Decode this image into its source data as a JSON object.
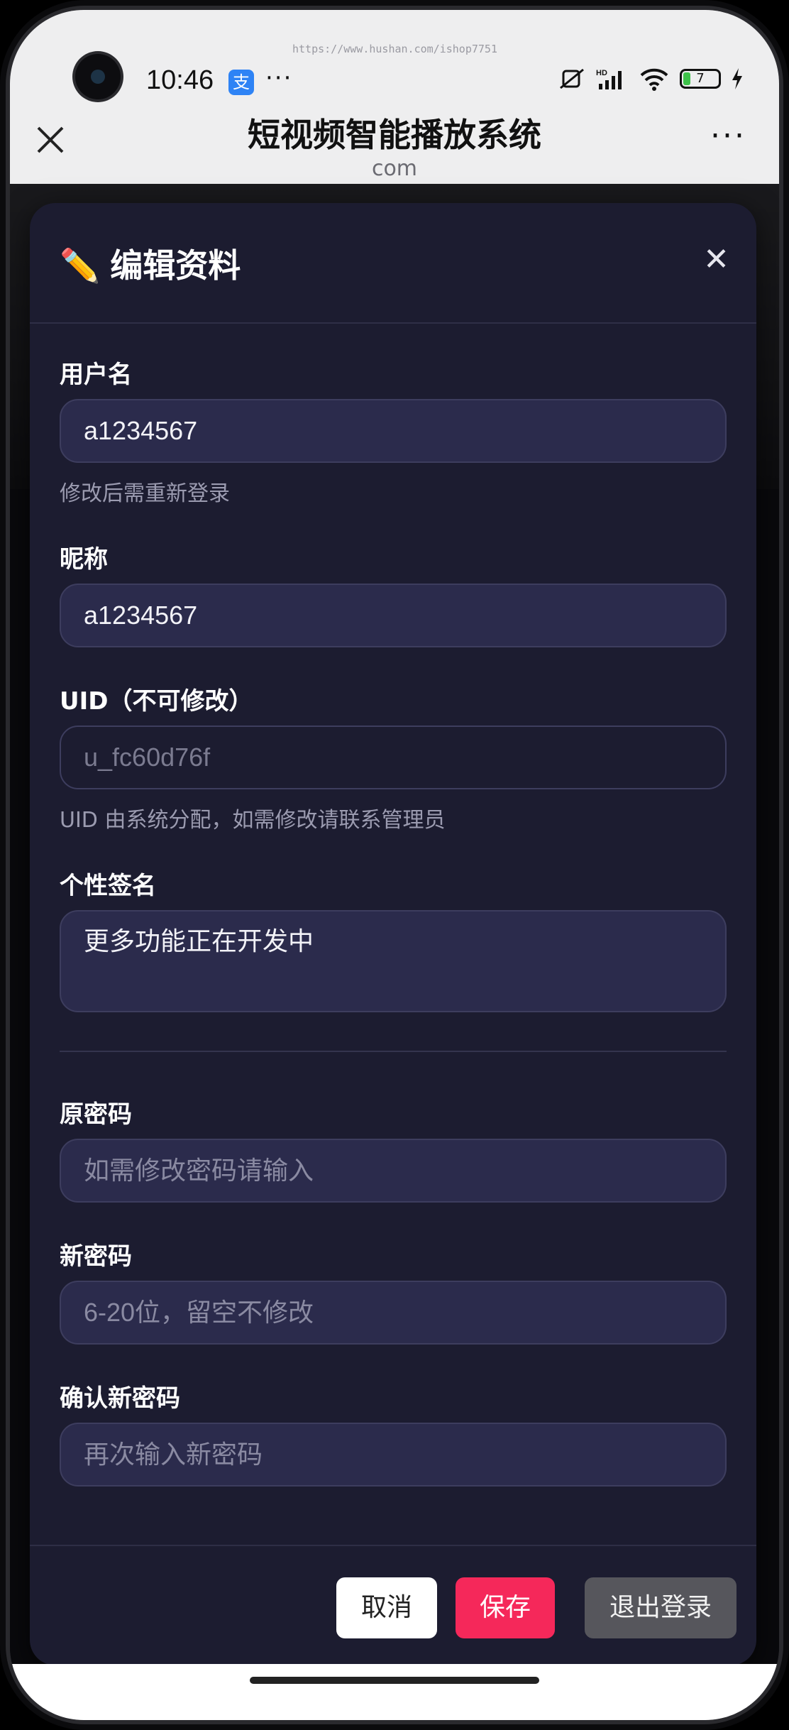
{
  "status_bar": {
    "time": "10:46",
    "alipay_glyph": "支",
    "dots": "···",
    "watermark": "https://www.hushan.com/ishop7751",
    "battery": "7",
    "icons": [
      "mute-vibrate-icon",
      "hd-signal-icon",
      "wifi-icon",
      "battery-icon",
      "charging-icon"
    ]
  },
  "browser": {
    "title": "短视频智能播放系统",
    "subtitle": "com",
    "more": "···"
  },
  "modal": {
    "title": "编辑资料",
    "title_icon": "✏️",
    "close": "✕",
    "fields": {
      "username": {
        "label": "用户名",
        "value": "a1234567",
        "hint": "修改后需重新登录"
      },
      "nickname": {
        "label": "昵称",
        "value": "a1234567"
      },
      "uid": {
        "label": "UID（不可修改）",
        "value": "u_fc60d76f",
        "hint": "UID 由系统分配，如需修改请联系管理员"
      },
      "signature": {
        "label": "个性签名",
        "value": "更多功能正在开发中"
      },
      "old_password": {
        "label": "原密码",
        "placeholder": "如需修改密码请输入"
      },
      "new_password": {
        "label": "新密码",
        "placeholder": "6-20位，留空不修改"
      },
      "confirm_password": {
        "label": "确认新密码",
        "placeholder": "再次输入新密码"
      }
    },
    "buttons": {
      "cancel": "取消",
      "save": "保存",
      "logout": "退出登录"
    }
  },
  "colors": {
    "modal_bg": "#1c1c30",
    "input_bg": "#2b2b4c",
    "save": "#f5285a",
    "logout": "#56565c"
  }
}
